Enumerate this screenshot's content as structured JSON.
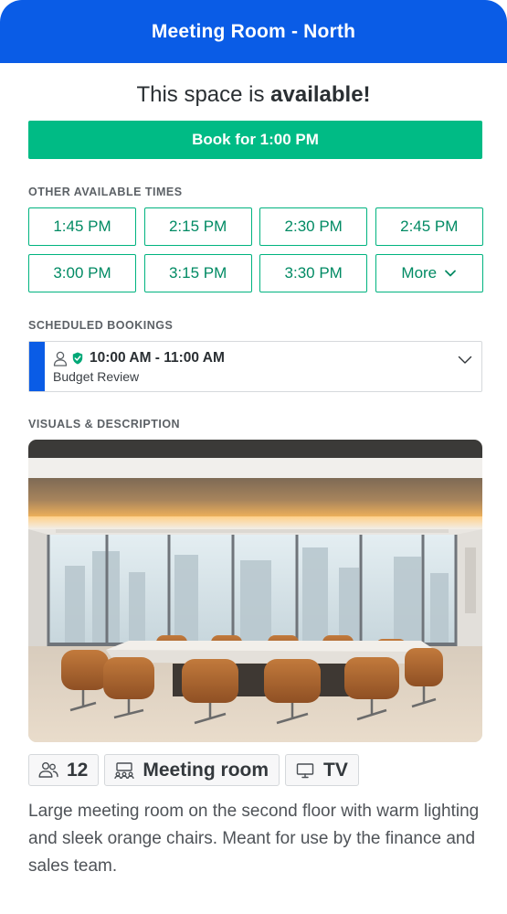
{
  "header": {
    "title": "Meeting Room - North"
  },
  "status": {
    "prefix": "This space is ",
    "highlight": "available!"
  },
  "book_button": {
    "label": "Book for 1:00 PM"
  },
  "other_times": {
    "label": "OTHER AVAILABLE TIMES",
    "times": [
      "1:45 PM",
      "2:15 PM",
      "2:30 PM",
      "2:45 PM",
      "3:00 PM",
      "3:15 PM",
      "3:30 PM"
    ],
    "more_label": "More"
  },
  "scheduled": {
    "label": "SCHEDULED BOOKINGS",
    "bookings": [
      {
        "time": "10:00 AM - 11:00 AM",
        "title": "Budget Review"
      }
    ]
  },
  "visuals": {
    "label": "VISUALS & DESCRIPTION",
    "capacity": "12",
    "room_type": "Meeting room",
    "equipment": "TV",
    "description": "Large meeting room on the second floor with warm lighting and sleek orange chairs. Meant for use by the finance and sales team."
  },
  "colors": {
    "brand": "#0a5ce6",
    "accent_green": "#00bb85",
    "time_text": "#008a63"
  }
}
